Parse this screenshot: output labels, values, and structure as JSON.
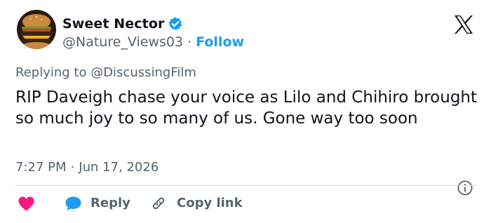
{
  "author": {
    "display_name": "Sweet Nector",
    "handle": "@Nature_Views03",
    "separator": "·",
    "follow_label": "Follow"
  },
  "reply_context": "Replying to @DiscussingFilm",
  "tweet": {
    "text": "RIP Daveigh chase your voice as Lilo and Chihiro brought so much joy to so many of us. Gone way too soon",
    "time": "7:27 PM",
    "separator": "·",
    "date": "Jun 17, 2026"
  },
  "actions": {
    "reply_label": "Reply",
    "copy_link_label": "Copy link"
  },
  "icons": {
    "avatar": "burger-avatar",
    "verified": "verified-badge-icon",
    "logo": "x-logo-icon",
    "like": "heart-icon",
    "reply": "reply-bubble-icon",
    "link": "link-icon",
    "info": "info-icon"
  },
  "colors": {
    "accent": "#1d9bf0",
    "like": "#f91880",
    "text": "#0f1419",
    "muted": "#536471",
    "divider": "#cfd9de"
  }
}
